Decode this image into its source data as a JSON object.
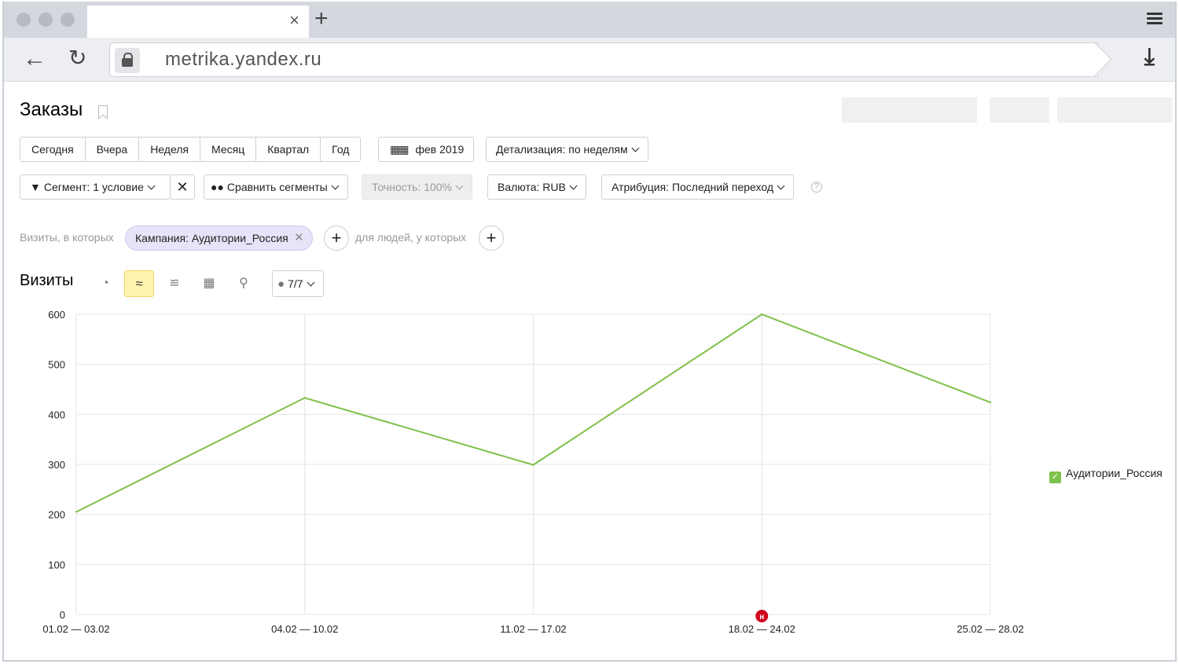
{
  "browser": {
    "tab_close": "×",
    "new_tab": "+",
    "url": "metrika.yandex.ru"
  },
  "page": {
    "title": "Заказы"
  },
  "period": {
    "buttons": [
      "Сегодня",
      "Вчера",
      "Неделя",
      "Месяц",
      "Квартал",
      "Год"
    ],
    "date_label": "фев 2019",
    "detail_label": "Детализация: по неделям"
  },
  "toolbar": {
    "segment_label": "Сегмент: 1 условие",
    "compare_label": "Сравнить сегменты",
    "accuracy_label": "Точность: 100%",
    "currency_label": "Валюта: RUB",
    "attribution_label": "Атрибуция: Последний переход"
  },
  "filters": {
    "visits_prefix": "Визиты, в которых",
    "chip_label": "Кампания: Аудитории_Россия",
    "people_prefix": "для людей, у которых"
  },
  "chart_header": {
    "title": "Визиты",
    "series_count": "7/7"
  },
  "chart_data": {
    "type": "line",
    "categories": [
      "01.02 — 03.02",
      "04.02 — 10.02",
      "11.02 — 17.02",
      "18.02 — 24.02",
      "25.02 — 28.02"
    ],
    "series": [
      {
        "name": "Аудитории_Россия",
        "values": [
          205,
          433,
          299,
          600,
          424
        ],
        "color": "#7ec14a"
      }
    ],
    "yticks": [
      0,
      100,
      200,
      300,
      400,
      500,
      600
    ],
    "ylim": [
      0,
      600
    ],
    "grid": true,
    "legend": "right",
    "annotation": {
      "category": "18.02 — 24.02",
      "label": "н",
      "color": "#d0021b"
    }
  }
}
